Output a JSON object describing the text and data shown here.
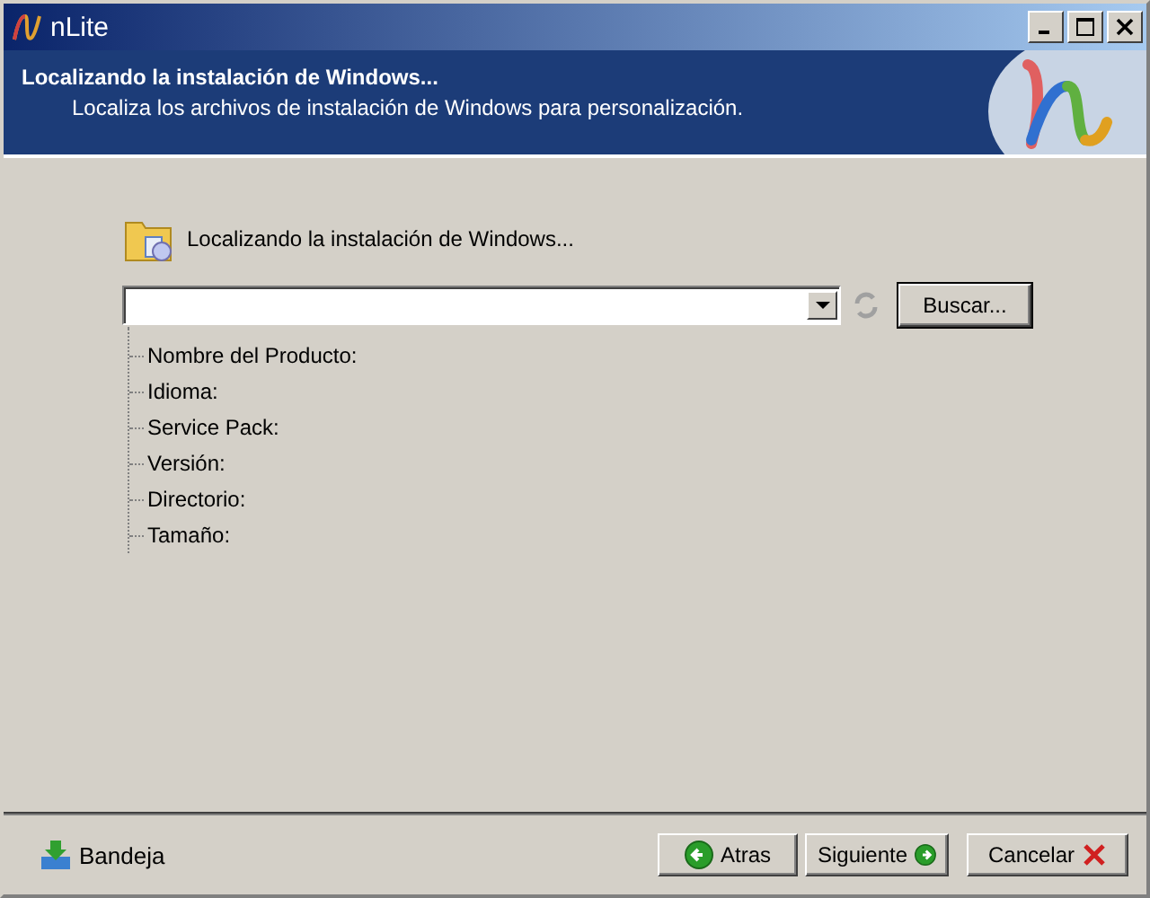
{
  "window": {
    "title": "nLite"
  },
  "header": {
    "title": "Localizando la instalación de Windows...",
    "subtitle": "Localiza los archivos de instalación de Windows para personalización."
  },
  "section": {
    "title": "Localizando la instalación de Windows..."
  },
  "browse_button": "Buscar...",
  "details": [
    {
      "label": "Nombre del Producto:"
    },
    {
      "label": "Idioma:"
    },
    {
      "label": "Service Pack:"
    },
    {
      "label": "Versión:"
    },
    {
      "label": "Directorio:"
    },
    {
      "label": "Tamaño:"
    }
  ],
  "tray": {
    "label": "Bandeja"
  },
  "buttons": [
    {
      "kind": "back",
      "label": "Atras"
    },
    {
      "kind": "next",
      "label": "Siguiente"
    },
    {
      "kind": "cancel",
      "label": "Cancelar"
    }
  ]
}
